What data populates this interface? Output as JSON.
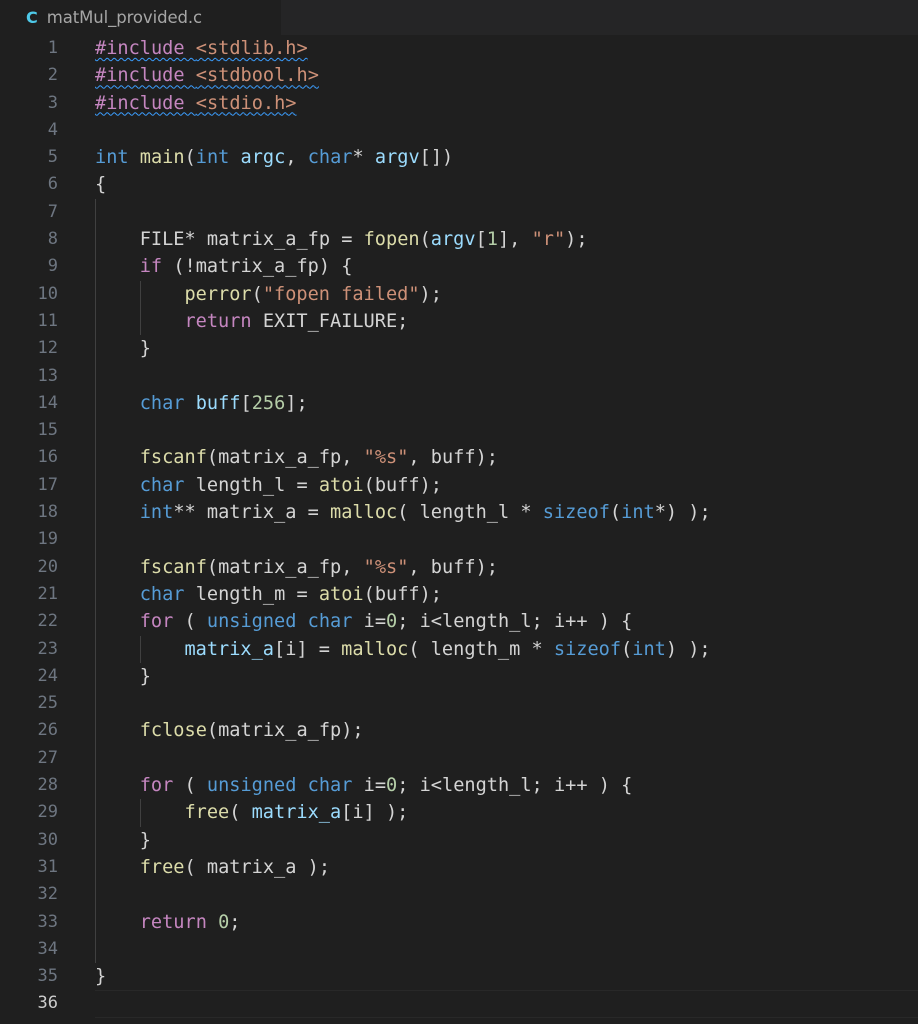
{
  "tab": {
    "icon": "c-language-icon",
    "icon_glyph": "C",
    "filename": "matMul_provided.c",
    "icon_color": "#4ec9e8",
    "label_color": "#a6a6a6"
  },
  "editor": {
    "language": "c",
    "theme": "Dark+",
    "current_line": 36,
    "total_lines": 36,
    "background": "#1f1f1f",
    "indent_size": 4,
    "colors": {
      "plain": "#d4d4d4",
      "keyword": "#569cd6",
      "control": "#c586c0",
      "function": "#dcdcaa",
      "variable": "#9cdcfe",
      "string": "#ce9178",
      "number": "#b5cea8",
      "line_number": "#6e7681",
      "line_number_active": "#cccccc",
      "error_squiggle": "#3b9eff",
      "indent_guide": "#404040"
    }
  },
  "lines": [
    {
      "n": 1,
      "indent": 0,
      "guides": 0,
      "tokens": [
        {
          "t": "#include ",
          "c": "ctrl",
          "sq": true
        },
        {
          "t": "<stdlib.h>",
          "c": "str",
          "sq": true
        }
      ]
    },
    {
      "n": 2,
      "indent": 0,
      "guides": 0,
      "tokens": [
        {
          "t": "#include ",
          "c": "ctrl",
          "sq": true
        },
        {
          "t": "<stdbool.h>",
          "c": "str",
          "sq": true
        }
      ]
    },
    {
      "n": 3,
      "indent": 0,
      "guides": 0,
      "tokens": [
        {
          "t": "#include ",
          "c": "ctrl",
          "sq": true
        },
        {
          "t": "<stdio.h>",
          "c": "str",
          "sq": true
        }
      ]
    },
    {
      "n": 4,
      "indent": 0,
      "guides": 0,
      "tokens": []
    },
    {
      "n": 5,
      "indent": 0,
      "guides": 0,
      "tokens": [
        {
          "t": "int ",
          "c": "kw"
        },
        {
          "t": "main",
          "c": "fn"
        },
        {
          "t": "(",
          "c": "punct"
        },
        {
          "t": "int ",
          "c": "kw"
        },
        {
          "t": "argc",
          "c": "var"
        },
        {
          "t": ", ",
          "c": "punct"
        },
        {
          "t": "char",
          "c": "kw"
        },
        {
          "t": "* ",
          "c": "punct"
        },
        {
          "t": "argv",
          "c": "var"
        },
        {
          "t": "[])",
          "c": "punct"
        }
      ]
    },
    {
      "n": 6,
      "indent": 0,
      "guides": 0,
      "tokens": [
        {
          "t": "{",
          "c": "punct"
        }
      ]
    },
    {
      "n": 7,
      "indent": 0,
      "guides": 1,
      "tokens": []
    },
    {
      "n": 8,
      "indent": 4,
      "guides": 1,
      "tokens": [
        {
          "t": "FILE* matrix_a_fp ",
          "c": "plain"
        },
        {
          "t": "= ",
          "c": "punct"
        },
        {
          "t": "fopen",
          "c": "fn"
        },
        {
          "t": "(",
          "c": "punct"
        },
        {
          "t": "argv",
          "c": "var"
        },
        {
          "t": "[",
          "c": "punct"
        },
        {
          "t": "1",
          "c": "num"
        },
        {
          "t": "], ",
          "c": "punct"
        },
        {
          "t": "\"r\"",
          "c": "str"
        },
        {
          "t": ");",
          "c": "punct"
        }
      ]
    },
    {
      "n": 9,
      "indent": 4,
      "guides": 1,
      "tokens": [
        {
          "t": "if ",
          "c": "ctrl"
        },
        {
          "t": "(!matrix_a_fp) {",
          "c": "plain"
        }
      ]
    },
    {
      "n": 10,
      "indent": 8,
      "guides": 2,
      "tokens": [
        {
          "t": "perror",
          "c": "fn"
        },
        {
          "t": "(",
          "c": "punct"
        },
        {
          "t": "\"fopen failed\"",
          "c": "str"
        },
        {
          "t": ");",
          "c": "punct"
        }
      ]
    },
    {
      "n": 11,
      "indent": 8,
      "guides": 2,
      "tokens": [
        {
          "t": "return ",
          "c": "ctrl"
        },
        {
          "t": "EXIT_FAILURE;",
          "c": "plain"
        }
      ]
    },
    {
      "n": 12,
      "indent": 4,
      "guides": 1,
      "tokens": [
        {
          "t": "}",
          "c": "punct"
        }
      ]
    },
    {
      "n": 13,
      "indent": 0,
      "guides": 1,
      "tokens": []
    },
    {
      "n": 14,
      "indent": 4,
      "guides": 1,
      "tokens": [
        {
          "t": "char ",
          "c": "kw"
        },
        {
          "t": "buff",
          "c": "var"
        },
        {
          "t": "[",
          "c": "punct"
        },
        {
          "t": "256",
          "c": "num"
        },
        {
          "t": "];",
          "c": "punct"
        }
      ]
    },
    {
      "n": 15,
      "indent": 0,
      "guides": 1,
      "tokens": []
    },
    {
      "n": 16,
      "indent": 4,
      "guides": 1,
      "tokens": [
        {
          "t": "fscanf",
          "c": "fn"
        },
        {
          "t": "(matrix_a_fp, ",
          "c": "plain"
        },
        {
          "t": "\"%s\"",
          "c": "str"
        },
        {
          "t": ", buff);",
          "c": "plain"
        }
      ]
    },
    {
      "n": 17,
      "indent": 4,
      "guides": 1,
      "tokens": [
        {
          "t": "char ",
          "c": "kw"
        },
        {
          "t": "length_l ",
          "c": "plain"
        },
        {
          "t": "= ",
          "c": "punct"
        },
        {
          "t": "atoi",
          "c": "fn"
        },
        {
          "t": "(buff);",
          "c": "plain"
        }
      ]
    },
    {
      "n": 18,
      "indent": 4,
      "guides": 1,
      "tokens": [
        {
          "t": "int",
          "c": "kw"
        },
        {
          "t": "** matrix_a ",
          "c": "plain"
        },
        {
          "t": "= ",
          "c": "punct"
        },
        {
          "t": "malloc",
          "c": "fn"
        },
        {
          "t": "( length_l * ",
          "c": "plain"
        },
        {
          "t": "sizeof",
          "c": "kw"
        },
        {
          "t": "(",
          "c": "punct"
        },
        {
          "t": "int",
          "c": "kw"
        },
        {
          "t": "*) );",
          "c": "plain"
        }
      ]
    },
    {
      "n": 19,
      "indent": 0,
      "guides": 1,
      "tokens": []
    },
    {
      "n": 20,
      "indent": 4,
      "guides": 1,
      "tokens": [
        {
          "t": "fscanf",
          "c": "fn"
        },
        {
          "t": "(matrix_a_fp, ",
          "c": "plain"
        },
        {
          "t": "\"%s\"",
          "c": "str"
        },
        {
          "t": ", buff);",
          "c": "plain"
        }
      ]
    },
    {
      "n": 21,
      "indent": 4,
      "guides": 1,
      "tokens": [
        {
          "t": "char ",
          "c": "kw"
        },
        {
          "t": "length_m ",
          "c": "plain"
        },
        {
          "t": "= ",
          "c": "punct"
        },
        {
          "t": "atoi",
          "c": "fn"
        },
        {
          "t": "(buff);",
          "c": "plain"
        }
      ]
    },
    {
      "n": 22,
      "indent": 4,
      "guides": 1,
      "tokens": [
        {
          "t": "for ",
          "c": "ctrl"
        },
        {
          "t": "( ",
          "c": "punct"
        },
        {
          "t": "unsigned char ",
          "c": "kw"
        },
        {
          "t": "i=",
          "c": "plain"
        },
        {
          "t": "0",
          "c": "num"
        },
        {
          "t": "; i<length_l; i++ ) {",
          "c": "plain"
        }
      ]
    },
    {
      "n": 23,
      "indent": 8,
      "guides": 2,
      "tokens": [
        {
          "t": "matrix_a",
          "c": "var"
        },
        {
          "t": "[i] ",
          "c": "plain"
        },
        {
          "t": "= ",
          "c": "punct"
        },
        {
          "t": "malloc",
          "c": "fn"
        },
        {
          "t": "( length_m * ",
          "c": "plain"
        },
        {
          "t": "sizeof",
          "c": "kw"
        },
        {
          "t": "(",
          "c": "punct"
        },
        {
          "t": "int",
          "c": "kw"
        },
        {
          "t": ") );",
          "c": "plain"
        }
      ]
    },
    {
      "n": 24,
      "indent": 4,
      "guides": 1,
      "tokens": [
        {
          "t": "}",
          "c": "punct"
        }
      ]
    },
    {
      "n": 25,
      "indent": 0,
      "guides": 1,
      "tokens": []
    },
    {
      "n": 26,
      "indent": 4,
      "guides": 1,
      "tokens": [
        {
          "t": "fclose",
          "c": "fn"
        },
        {
          "t": "(matrix_a_fp);",
          "c": "plain"
        }
      ]
    },
    {
      "n": 27,
      "indent": 0,
      "guides": 1,
      "tokens": []
    },
    {
      "n": 28,
      "indent": 4,
      "guides": 1,
      "tokens": [
        {
          "t": "for ",
          "c": "ctrl"
        },
        {
          "t": "( ",
          "c": "punct"
        },
        {
          "t": "unsigned char ",
          "c": "kw"
        },
        {
          "t": "i=",
          "c": "plain"
        },
        {
          "t": "0",
          "c": "num"
        },
        {
          "t": "; i<length_l; i++ ) {",
          "c": "plain"
        }
      ]
    },
    {
      "n": 29,
      "indent": 8,
      "guides": 2,
      "tokens": [
        {
          "t": "free",
          "c": "fn"
        },
        {
          "t": "( ",
          "c": "punct"
        },
        {
          "t": "matrix_a",
          "c": "var"
        },
        {
          "t": "[i] );",
          "c": "plain"
        }
      ]
    },
    {
      "n": 30,
      "indent": 4,
      "guides": 1,
      "tokens": [
        {
          "t": "}",
          "c": "punct"
        }
      ]
    },
    {
      "n": 31,
      "indent": 4,
      "guides": 1,
      "tokens": [
        {
          "t": "free",
          "c": "fn"
        },
        {
          "t": "( matrix_a );",
          "c": "plain"
        }
      ]
    },
    {
      "n": 32,
      "indent": 0,
      "guides": 1,
      "tokens": []
    },
    {
      "n": 33,
      "indent": 4,
      "guides": 1,
      "tokens": [
        {
          "t": "return ",
          "c": "ctrl"
        },
        {
          "t": "0",
          "c": "num"
        },
        {
          "t": ";",
          "c": "punct"
        }
      ]
    },
    {
      "n": 34,
      "indent": 0,
      "guides": 1,
      "tokens": []
    },
    {
      "n": 35,
      "indent": 0,
      "guides": 0,
      "tokens": [
        {
          "t": "}",
          "c": "punct"
        }
      ]
    },
    {
      "n": 36,
      "indent": 0,
      "guides": 0,
      "tokens": []
    }
  ]
}
